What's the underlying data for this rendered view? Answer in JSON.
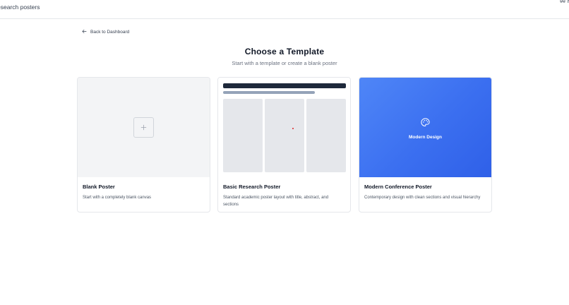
{
  "header": {
    "brand_text": "esearch posters",
    "right_label": "Ho"
  },
  "back_link": {
    "label": "Back to Dashboard"
  },
  "page": {
    "title": "Choose a Template",
    "subtitle": "Start with a template or create a blank poster"
  },
  "templates": [
    {
      "title": "Blank Poster",
      "description": "Start with a completely blank canvas"
    },
    {
      "title": "Basic Research Poster",
      "description": "Standard academic poster layout with title, abstract, and sections"
    },
    {
      "title": "Modern Conference Poster",
      "description": "Contemporary design with clean sections and visual hierarchy",
      "preview_label": "Modern Design"
    }
  ],
  "icons": [
    "home-icon",
    "arrow-left-icon",
    "plus-icon",
    "palette-icon"
  ],
  "colors": {
    "accent_blue": "#3b6ff0",
    "dark_bar": "#1e293b",
    "muted_bar": "#94a3b8",
    "panel_gray": "#e5e7eb",
    "marker_red": "#dc2626"
  }
}
